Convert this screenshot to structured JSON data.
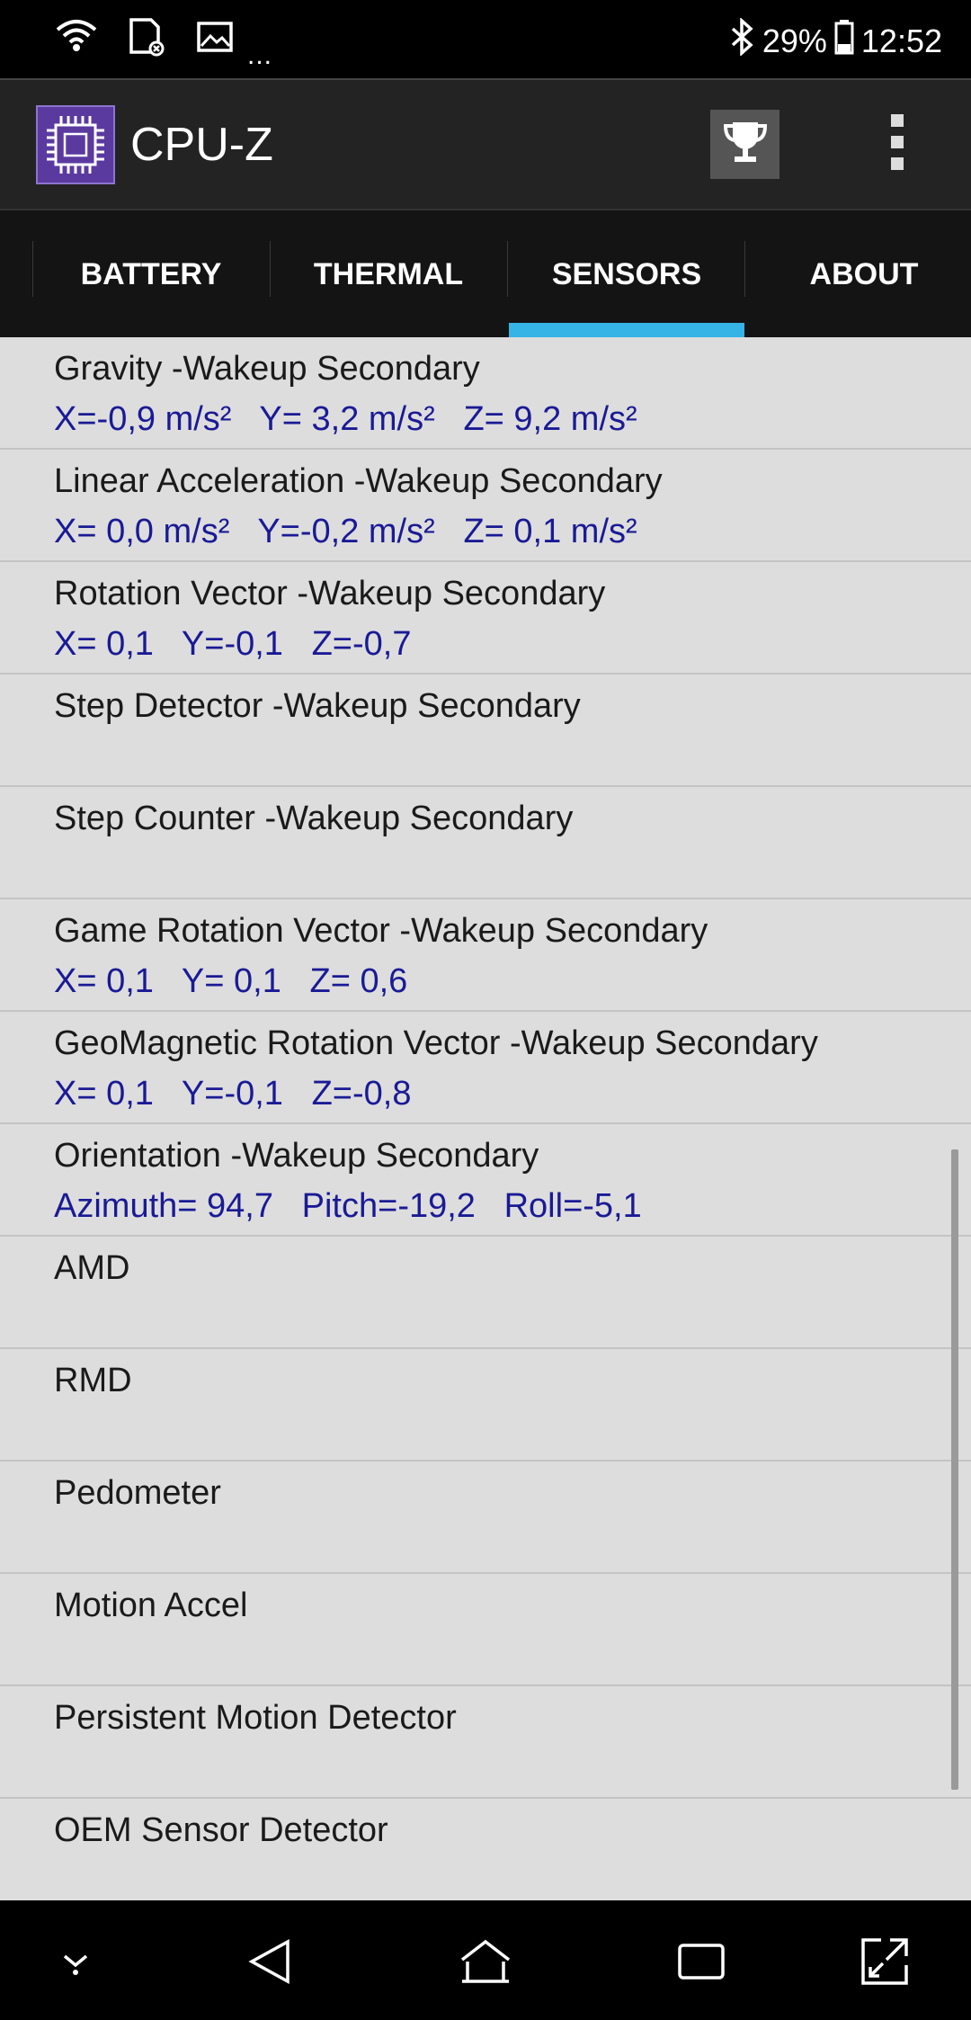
{
  "status_bar": {
    "overflow_dots": "...",
    "battery_percent": "29%",
    "time": "12:52",
    "icons": [
      "wifi-icon",
      "sd-card-icon",
      "image-icon",
      "bluetooth-icon",
      "battery-icon"
    ]
  },
  "app_bar": {
    "title": "CPU-Z",
    "icons": [
      "app-logo",
      "trophy-icon",
      "more-vert-icon"
    ]
  },
  "tabs": [
    {
      "label": "BATTERY",
      "selected": false
    },
    {
      "label": "THERMAL",
      "selected": false
    },
    {
      "label": "SENSORS",
      "selected": true
    },
    {
      "label": "ABOUT",
      "selected": false
    }
  ],
  "sensors": [
    {
      "name": "Gravity -Wakeup Secondary",
      "values": "X=-0,9 m/s²   Y= 3,2 m/s²   Z= 9,2 m/s²"
    },
    {
      "name": "Linear Acceleration -Wakeup Secondary",
      "values": "X= 0,0 m/s²   Y=-0,2 m/s²   Z= 0,1 m/s²"
    },
    {
      "name": "Rotation Vector -Wakeup Secondary",
      "values": "X= 0,1   Y=-0,1   Z=-0,7"
    },
    {
      "name": "Step Detector -Wakeup Secondary",
      "values": ""
    },
    {
      "name": "Step Counter -Wakeup Secondary",
      "values": ""
    },
    {
      "name": "Game Rotation Vector -Wakeup Secondary",
      "values": "X= 0,1   Y= 0,1   Z= 0,6"
    },
    {
      "name": "GeoMagnetic Rotation Vector -Wakeup Secondary",
      "values": "X= 0,1   Y=-0,1   Z=-0,8"
    },
    {
      "name": "Orientation -Wakeup Secondary",
      "values": "Azimuth= 94,7   Pitch=-19,2   Roll=-5,1"
    },
    {
      "name": "AMD",
      "values": ""
    },
    {
      "name": "RMD",
      "values": ""
    },
    {
      "name": "Pedometer",
      "values": ""
    },
    {
      "name": "Motion Accel",
      "values": ""
    },
    {
      "name": "Persistent Motion Detector",
      "values": ""
    },
    {
      "name": "OEM Sensor Detector",
      "values": ""
    }
  ],
  "nav_bar": {
    "icons": [
      "chevron-down-icon",
      "back-icon",
      "home-icon",
      "recents-icon",
      "screen-expand-icon"
    ]
  },
  "colors": {
    "accent": "#36b4e6",
    "value_text": "#1a1a96",
    "list_background": "#dddddd"
  }
}
